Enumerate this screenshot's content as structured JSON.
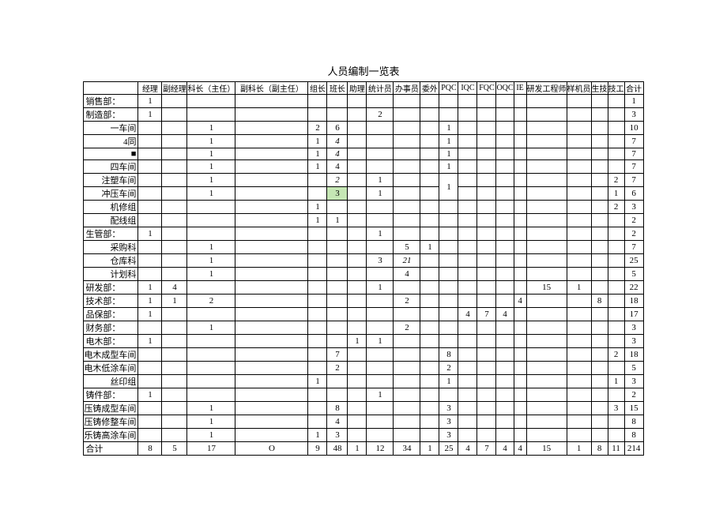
{
  "title": "人员编制一览表",
  "columns": [
    "",
    "经理",
    "副经理",
    "科长（主任）",
    "副科长（副主任）",
    "组长",
    "班长",
    "助理",
    "统计员",
    "办事员",
    "委外",
    "PQC",
    "IQC",
    "FQC",
    "OQC",
    "IE",
    "研发工程师",
    "样机员",
    "生技",
    "技工",
    "合计"
  ],
  "rows": [
    {
      "label": "销售部：",
      "align": "left",
      "cells": [
        "1",
        "",
        "",
        "",
        "",
        "",
        "",
        "",
        "",
        "",
        "",
        "",
        "",
        "",
        "",
        "",
        "",
        "",
        "",
        "1"
      ]
    },
    {
      "label": "制造部：",
      "align": "left",
      "cells": [
        "1",
        "",
        "",
        "",
        "",
        "",
        "",
        "2",
        "",
        "",
        "",
        "",
        "",
        "",
        "",
        "",
        "",
        "",
        "",
        "3"
      ]
    },
    {
      "label": "一车间",
      "align": "right",
      "cells": [
        "",
        "",
        "1",
        "",
        "2",
        "6",
        "",
        "",
        "",
        "",
        "1",
        "",
        "",
        "",
        "",
        "",
        "",
        "",
        "",
        "10"
      ]
    },
    {
      "label": "4同",
      "align": "right",
      "cells": [
        "",
        "",
        "1",
        "",
        "1",
        "4",
        "",
        "",
        "",
        "",
        "1",
        "",
        "",
        "",
        "",
        "",
        "",
        "",
        "",
        "7"
      ],
      "italic": [
        6
      ]
    },
    {
      "label": "■",
      "align": "right",
      "square": true,
      "cells": [
        "",
        "",
        "1",
        "",
        "1",
        "4",
        "",
        "",
        "",
        "",
        "1",
        "",
        "",
        "",
        "",
        "",
        "",
        "",
        "",
        "7"
      ],
      "italic": [
        6
      ]
    },
    {
      "label": "四车间",
      "align": "right",
      "cells": [
        "",
        "",
        "1",
        "",
        "1",
        "4",
        "",
        "",
        "",
        "",
        "1",
        "",
        "",
        "",
        "",
        "",
        "",
        "",
        "",
        "7"
      ]
    },
    {
      "label": "注塑车间",
      "align": "right",
      "cells": [
        "",
        "",
        "1",
        "",
        "",
        "2",
        "",
        "1",
        "",
        "",
        "",
        "",
        "",
        "",
        "",
        "",
        "",
        "",
        "2",
        "7"
      ],
      "italic": [
        6
      ],
      "merge_pqc": true
    },
    {
      "label": "冲压车间",
      "align": "right",
      "cells": [
        "",
        "",
        "1",
        "",
        "",
        "3",
        "",
        "1",
        "",
        "",
        "",
        "",
        "",
        "",
        "",
        "",
        "",
        "",
        "1",
        "6"
      ],
      "hl": [
        6
      ],
      "skip_pqc": true
    },
    {
      "label": "机修组",
      "align": "right",
      "cells": [
        "",
        "",
        "",
        "",
        "1",
        "",
        "",
        "",
        "",
        "",
        "",
        "",
        "",
        "",
        "",
        "",
        "",
        "",
        "2",
        "3"
      ]
    },
    {
      "label": "配线组",
      "align": "right",
      "cells": [
        "",
        "",
        "",
        "",
        "1",
        "1",
        "",
        "",
        "",
        "",
        "",
        "",
        "",
        "",
        "",
        "",
        "",
        "",
        "",
        "2"
      ]
    },
    {
      "label": "生管部：",
      "align": "left",
      "cells": [
        "1",
        "",
        "",
        "",
        "",
        "",
        "",
        "1",
        "",
        "",
        "",
        "",
        "",
        "",
        "",
        "",
        "",
        "",
        "",
        "2"
      ]
    },
    {
      "label": "采购科",
      "align": "right",
      "cells": [
        "",
        "",
        "1",
        "",
        "",
        "",
        "",
        "",
        "5",
        "1",
        "",
        "",
        "",
        "",
        "",
        "",
        "",
        "",
        "",
        "7"
      ]
    },
    {
      "label": "仓库科",
      "align": "right",
      "cells": [
        "",
        "",
        "1",
        "",
        "",
        "",
        "",
        "3",
        "21",
        "",
        "",
        "",
        "",
        "",
        "",
        "",
        "",
        "",
        "",
        "25"
      ],
      "italic": [
        9
      ]
    },
    {
      "label": "计划科",
      "align": "right",
      "cells": [
        "",
        "",
        "1",
        "",
        "",
        "",
        "",
        "",
        "4",
        "",
        "",
        "",
        "",
        "",
        "",
        "",
        "",
        "",
        "",
        "5"
      ]
    },
    {
      "label": "研发部：",
      "align": "left",
      "cells": [
        "1",
        "4",
        "",
        "",
        "",
        "",
        "",
        "1",
        "",
        "",
        "",
        "",
        "",
        "",
        "",
        "15",
        "1",
        "",
        "",
        "22"
      ]
    },
    {
      "label": "技术部：",
      "align": "left",
      "cells": [
        "1",
        "1",
        "2",
        "",
        "",
        "",
        "",
        "",
        "2",
        "",
        "",
        "",
        "",
        "",
        "4",
        "",
        "",
        "8",
        "",
        "18"
      ]
    },
    {
      "label": "品保部：",
      "align": "left",
      "cells": [
        "1",
        "",
        "",
        "",
        "",
        "",
        "",
        "",
        "",
        "",
        "",
        "4",
        "7",
        "4",
        "",
        "",
        "",
        "",
        "",
        "17"
      ]
    },
    {
      "label": "财务部：",
      "align": "left",
      "cells": [
        "",
        "",
        "1",
        "",
        "",
        "",
        "",
        "",
        "2",
        "",
        "",
        "",
        "",
        "",
        "",
        "",
        "",
        "",
        "",
        "3"
      ]
    },
    {
      "label": "电木部：",
      "align": "left",
      "cells": [
        "1",
        "",
        "",
        "",
        "",
        "",
        "1",
        "1",
        "",
        "",
        "",
        "",
        "",
        "",
        "",
        "",
        "",
        "",
        "",
        "3"
      ]
    },
    {
      "label": "电木成型车间",
      "align": "right",
      "cells": [
        "",
        "",
        "",
        "",
        "",
        "7",
        "",
        "",
        "",
        "",
        "8",
        "",
        "",
        "",
        "",
        "",
        "",
        "",
        "2",
        "18"
      ]
    },
    {
      "label": "电木低涂车间",
      "align": "right",
      "cells": [
        "",
        "",
        "",
        "",
        "",
        "2",
        "",
        "",
        "",
        "",
        "2",
        "",
        "",
        "",
        "",
        "",
        "",
        "",
        "",
        "5"
      ]
    },
    {
      "label": "丝印组",
      "align": "right",
      "cells": [
        "",
        "",
        "",
        "",
        "1",
        "",
        "",
        "",
        "",
        "",
        "1",
        "",
        "",
        "",
        "",
        "",
        "",
        "",
        "1",
        "3"
      ]
    },
    {
      "label": "铸件部：",
      "align": "left",
      "cells": [
        "1",
        "",
        "",
        "",
        "",
        "",
        "",
        "1",
        "",
        "",
        "",
        "",
        "",
        "",
        "",
        "",
        "",
        "",
        "",
        "2"
      ]
    },
    {
      "label": "压铸成型车间",
      "align": "right",
      "cells": [
        "",
        "",
        "1",
        "",
        "",
        "8",
        "",
        "",
        "",
        "",
        "3",
        "",
        "",
        "",
        "",
        "",
        "",
        "",
        "3",
        "15"
      ]
    },
    {
      "label": "压铸修整车间",
      "align": "right",
      "cells": [
        "",
        "",
        "1",
        "",
        "",
        "4",
        "",
        "",
        "",
        "",
        "3",
        "",
        "",
        "",
        "",
        "",
        "",
        "",
        "",
        "8"
      ]
    },
    {
      "label": "乐铸高涂车间",
      "align": "right",
      "cells": [
        "",
        "",
        "1",
        "",
        "1",
        "3",
        "",
        "",
        "",
        "",
        "3",
        "",
        "",
        "",
        "",
        "",
        "",
        "",
        "",
        "8"
      ]
    },
    {
      "label": "合计",
      "align": "left",
      "cells": [
        "8",
        "5",
        "17",
        "O",
        "9",
        "48",
        "1",
        "12",
        "34",
        "1",
        "25",
        "4",
        "7",
        "4",
        "4",
        "15",
        "1",
        "8",
        "11",
        "214"
      ]
    }
  ]
}
